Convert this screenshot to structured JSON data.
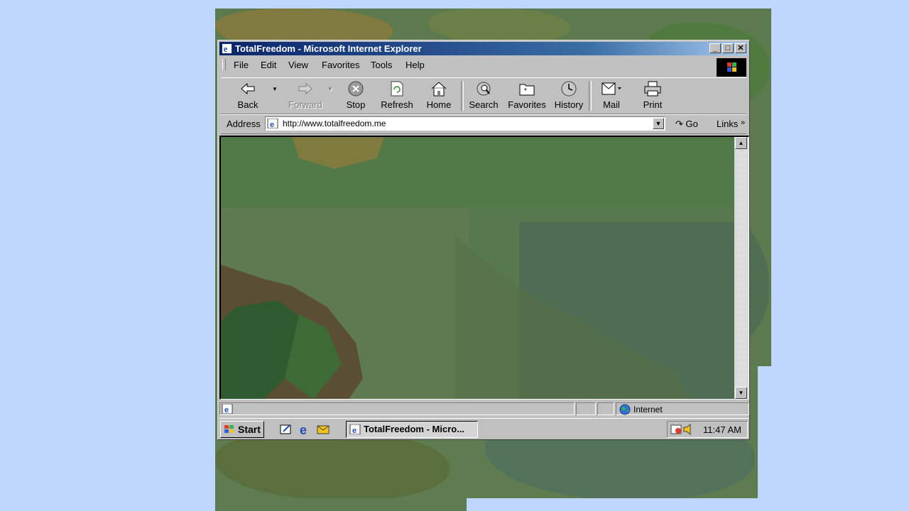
{
  "window": {
    "title": "TotalFreedom - Microsoft Internet Explorer",
    "minimize": "_",
    "maximize": "□",
    "close": "✕"
  },
  "menu": {
    "file": "File",
    "edit": "Edit",
    "view": "View",
    "favorites": "Favorites",
    "tools": "Tools",
    "help": "Help"
  },
  "toolbar": {
    "back": "Back",
    "forward": "Forward",
    "stop": "Stop",
    "refresh": "Refresh",
    "home": "Home",
    "search": "Search",
    "favorites": "Favorites",
    "history": "History",
    "mail": "Mail",
    "print": "Print"
  },
  "address": {
    "label": "Address",
    "url": "http://www.totalfreedom.me",
    "go": "Go",
    "links": "Links"
  },
  "status": {
    "zone": "Internet"
  },
  "taskbar": {
    "start": "Start",
    "task": "TotalFreedom - Micro...",
    "clock": "11:47 AM"
  },
  "colors": {
    "desktop": "#bfd6ff",
    "title_start": "#0a246a",
    "title_end": "#a6caf0",
    "chrome": "#c0c0c0"
  }
}
